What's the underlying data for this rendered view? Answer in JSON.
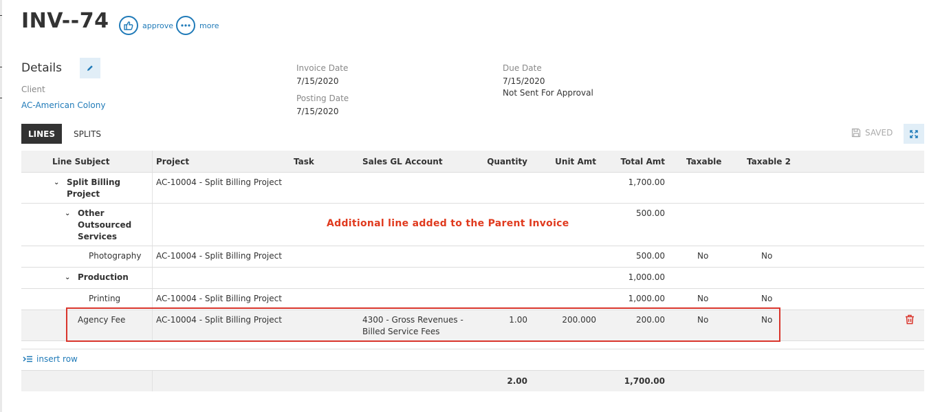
{
  "header": {
    "title": "INV--74",
    "approve_label": "approve",
    "more_label": "more"
  },
  "details": {
    "title": "Details",
    "client_label": "Client",
    "client_value": "AC-American Colony",
    "invoice_date_label": "Invoice Date",
    "invoice_date_value": "7/15/2020",
    "posting_date_label": "Posting Date",
    "posting_date_value": "7/15/2020",
    "due_date_label": "Due Date",
    "due_date_value": "7/15/2020",
    "approval_status": "Not Sent For Approval"
  },
  "tabs": [
    {
      "label": "LINES",
      "active": true
    },
    {
      "label": "SPLITS",
      "active": false
    }
  ],
  "saved_label": "SAVED",
  "table": {
    "columns": [
      "Line Subject",
      "Project",
      "Task",
      "Sales GL Account",
      "Quantity",
      "Unit Amt",
      "Total Amt",
      "Taxable",
      "Taxable 2"
    ],
    "rows": [
      {
        "subject_line1": "Split Billing",
        "subject_line2": "Project",
        "project": "AC-10004 - Split Billing Project",
        "total": "1,700.00"
      },
      {
        "subject_line1": "Other",
        "subject_line2": "Outsourced",
        "subject_line3": "Services",
        "total": "500.00"
      },
      {
        "subject": "Photography",
        "project": "AC-10004 - Split Billing Project",
        "total": "500.00",
        "taxable": "No",
        "taxable2": "No"
      },
      {
        "subject": "Production",
        "total": "1,000.00"
      },
      {
        "subject": "Printing",
        "project": "AC-10004 - Split Billing Project",
        "total": "1,000.00",
        "taxable": "No",
        "taxable2": "No"
      },
      {
        "subject": "Agency Fee",
        "project": "AC-10004 - Split Billing Project",
        "gl_line1": "4300 - Gross Revenues -",
        "gl_line2": "Billed Service Fees",
        "quantity": "1.00",
        "unit": "200.000",
        "total": "200.00",
        "taxable": "No",
        "taxable2": "No"
      }
    ],
    "totals": {
      "quantity": "2.00",
      "total": "1,700.00"
    }
  },
  "annotation": "Additional line added to the Parent Invoice",
  "insert_row_label": "insert row",
  "colors": {
    "accent": "#1f7ab8",
    "annotation_red": "#e03a1e",
    "tab_active_bg": "#333333"
  }
}
